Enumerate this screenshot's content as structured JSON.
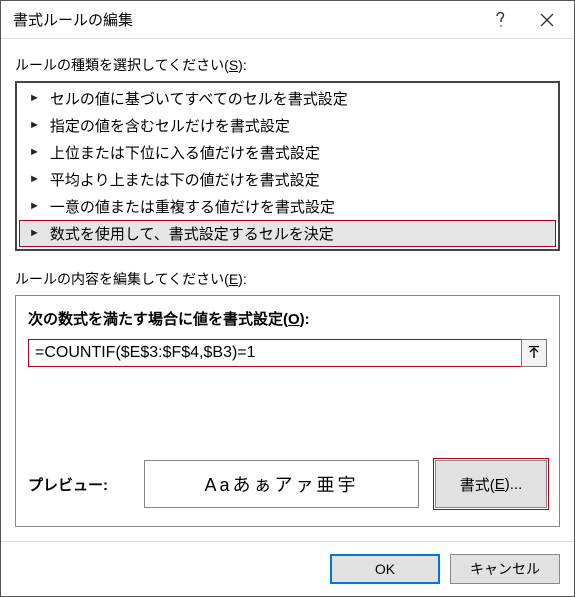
{
  "titlebar": {
    "title": "書式ルールの編集"
  },
  "sections": {
    "rule_type_label_pre": "ルールの種類を選択してください(",
    "rule_type_label_key": "S",
    "rule_type_label_post": "):",
    "rule_content_label_pre": "ルールの内容を編集してください(",
    "rule_content_label_key": "E",
    "rule_content_label_post": "):"
  },
  "rule_types": [
    {
      "label": "セルの値に基づいてすべてのセルを書式設定"
    },
    {
      "label": "指定の値を含むセルだけを書式設定"
    },
    {
      "label": "上位または下位に入る値だけを書式設定"
    },
    {
      "label": "平均より上または下の値だけを書式設定"
    },
    {
      "label": "一意の値または重複する値だけを書式設定"
    },
    {
      "label": "数式を使用して、書式設定するセルを決定"
    }
  ],
  "selected_rule_type_index": 5,
  "formula": {
    "label_pre": "次の数式を満たす場合に値を書式設定(",
    "label_key": "O",
    "label_post": "):",
    "value": "=COUNTIF($E$3:$F$4,$B3)=1"
  },
  "preview": {
    "label": "プレビュー:",
    "sample": "Aaあぁアァ亜宇",
    "format_button_pre": "書式(",
    "format_button_key": "E",
    "format_button_post": ")..."
  },
  "buttons": {
    "ok": "OK",
    "cancel": "キャンセル"
  }
}
